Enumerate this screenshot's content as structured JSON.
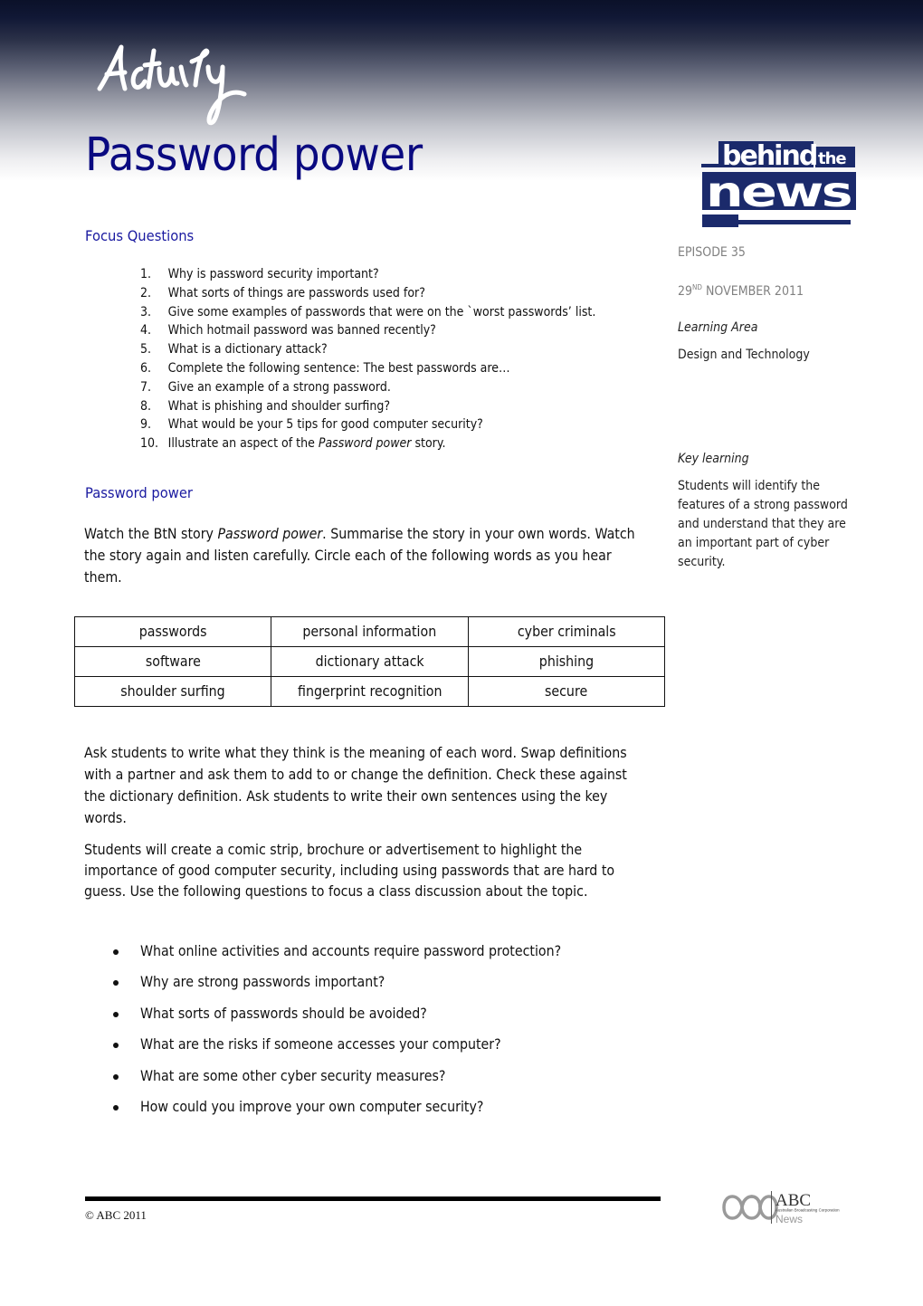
{
  "header": {
    "activity_label": "Activity",
    "title": "Password power",
    "brand_logo": {
      "line1": "behind",
      "line1b": "the",
      "line2": "news",
      "color": "#1b2a6b"
    }
  },
  "focus_questions": {
    "heading": "Focus Questions",
    "items": [
      {
        "num": "1.",
        "text": "Why is password security important?"
      },
      {
        "num": "2.",
        "text": "What sorts of things are passwords used for?"
      },
      {
        "num": "3.",
        "text": "Give some examples of passwords that were on the `worst passwords’ list."
      },
      {
        "num": "4.",
        "text": "Which hotmail password was banned recently?"
      },
      {
        "num": "5.",
        "text": "What is a dictionary attack?"
      },
      {
        "num": "6.",
        "text": "Complete the following sentence: The best passwords are…"
      },
      {
        "num": "7.",
        "text": "Give an example of a strong password."
      },
      {
        "num": "8.",
        "text": "What is phishing and shoulder surfing?"
      },
      {
        "num": "9.",
        "text": "What would be your 5 tips for good computer security?"
      },
      {
        "num": "10.",
        "text_before": "Illustrate an aspect of the ",
        "text_italic": "Password power",
        "text_after": " story."
      }
    ]
  },
  "sidebar": {
    "episode": "EPISODE 35",
    "date_day": "29",
    "date_suffix": "ND",
    "date_rest": " NOVEMBER 2011",
    "learning_area_label": "Learning Area",
    "learning_area_value": "Design and Technology",
    "key_learning_label": "Key learning",
    "key_learning_text": "Students will identify the features of a strong password and understand that they are an important part of cyber security."
  },
  "activity": {
    "heading": "Password power",
    "intro_before": "Watch the BtN story ",
    "intro_italic": "Password power",
    "intro_after": ".  Summarise the story in your own words. Watch the story again and listen carefully. Circle each of the following words as you hear them.",
    "words": [
      [
        "passwords",
        "personal information",
        "cyber criminals"
      ],
      [
        "software",
        "dictionary attack",
        "phishing"
      ],
      [
        "shoulder surfing",
        "fingerprint recognition",
        "secure"
      ]
    ],
    "para1": "Ask students to write what they think is the meaning of each word.   Swap definitions with a partner and ask them to add to or change the definition. Check these against the dictionary definition.  Ask students to write their own sentences using the key words.",
    "para2": "Students will create a comic strip, brochure or advertisement to highlight the importance of good computer security, including using passwords that are hard to guess.   Use the following questions to focus a class discussion about the topic.",
    "discussion": [
      "What online activities and accounts require password protection?",
      "Why are strong passwords important?",
      "What sorts of passwords should be avoided?",
      "What are the risks if someone accesses your computer?",
      "What are some other cyber security measures?",
      "How could you improve your own computer security?"
    ]
  },
  "footer": {
    "copyright": "© ABC 2011",
    "abc_logo": {
      "name": "ABC",
      "subtitle": "Australian Broadcasting Corporation",
      "division": "News"
    }
  },
  "colors": {
    "title_blue": "#0a0a80",
    "heading_blue": "#1a1aa0",
    "sidebar_grey": "#808080",
    "header_dark": "#0b1129"
  }
}
